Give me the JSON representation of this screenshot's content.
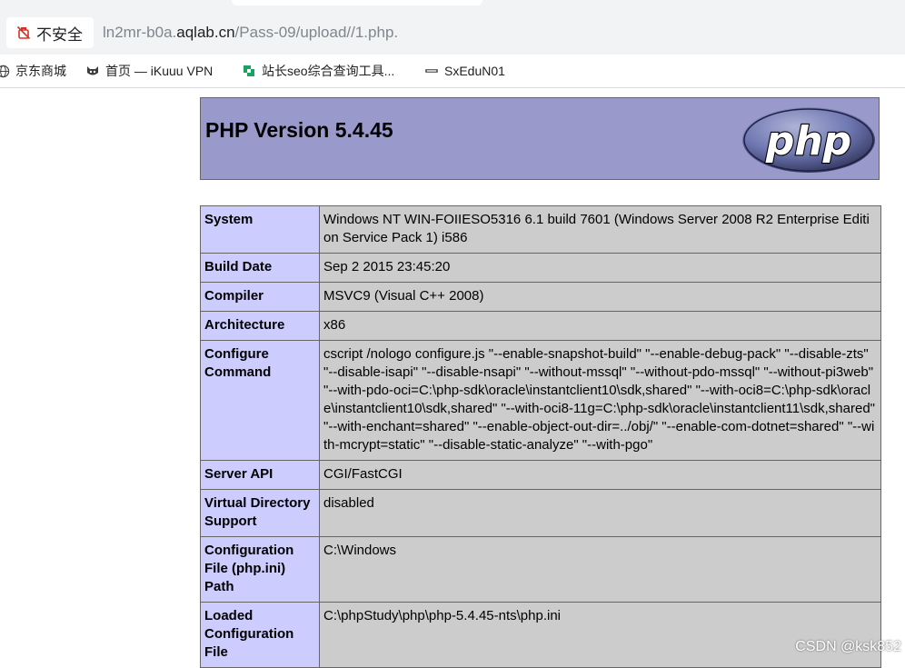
{
  "browser": {
    "security_label": "不安全",
    "url_prefix": "ln2mr-b0a.",
    "url_host": "aqlab.cn",
    "url_path": "/Pass-09/upload//1.php.",
    "bookmarks": [
      {
        "label": "京东商城",
        "icon": "globe-icon"
      },
      {
        "label": "首页 — iKuuu VPN",
        "icon": "cat-icon"
      },
      {
        "label": "站长seo综合查询工具...",
        "icon": "aizhan-icon"
      },
      {
        "label": "SxEduN01",
        "icon": "sxedu-icon"
      }
    ]
  },
  "php": {
    "title": "PHP Version 5.4.45",
    "logo_text": "php",
    "rows": [
      {
        "key": "System",
        "value": "Windows NT WIN-FOIIESO5316 6.1 build 7601 (Windows Server 2008 R2 Enterprise Edition Service Pack 1) i586"
      },
      {
        "key": "Build Date",
        "value": "Sep 2 2015 23:45:20"
      },
      {
        "key": "Compiler",
        "value": "MSVC9 (Visual C++ 2008)"
      },
      {
        "key": "Architecture",
        "value": "x86"
      },
      {
        "key": "Configure Command",
        "value": "cscript /nologo configure.js \"--enable-snapshot-build\" \"--enable-debug-pack\" \"--disable-zts\" \"--disable-isapi\" \"--disable-nsapi\" \"--without-mssql\" \"--without-pdo-mssql\" \"--without-pi3web\" \"--with-pdo-oci=C:\\php-sdk\\oracle\\instantclient10\\sdk,shared\" \"--with-oci8=C:\\php-sdk\\oracle\\instantclient10\\sdk,shared\" \"--with-oci8-11g=C:\\php-sdk\\oracle\\instantclient11\\sdk,shared\" \"--with-enchant=shared\" \"--enable-object-out-dir=../obj/\" \"--enable-com-dotnet=shared\" \"--with-mcrypt=static\" \"--disable-static-analyze\" \"--with-pgo\""
      },
      {
        "key": "Server API",
        "value": "CGI/FastCGI"
      },
      {
        "key": "Virtual Directory Support",
        "value": "disabled"
      },
      {
        "key": "Configuration File (php.ini) Path",
        "value": "C:\\Windows"
      },
      {
        "key": "Loaded Configuration File",
        "value": "C:\\phpStudy\\php\\php-5.4.45-nts\\php.ini"
      }
    ]
  },
  "watermark": "CSDN @ksk852"
}
